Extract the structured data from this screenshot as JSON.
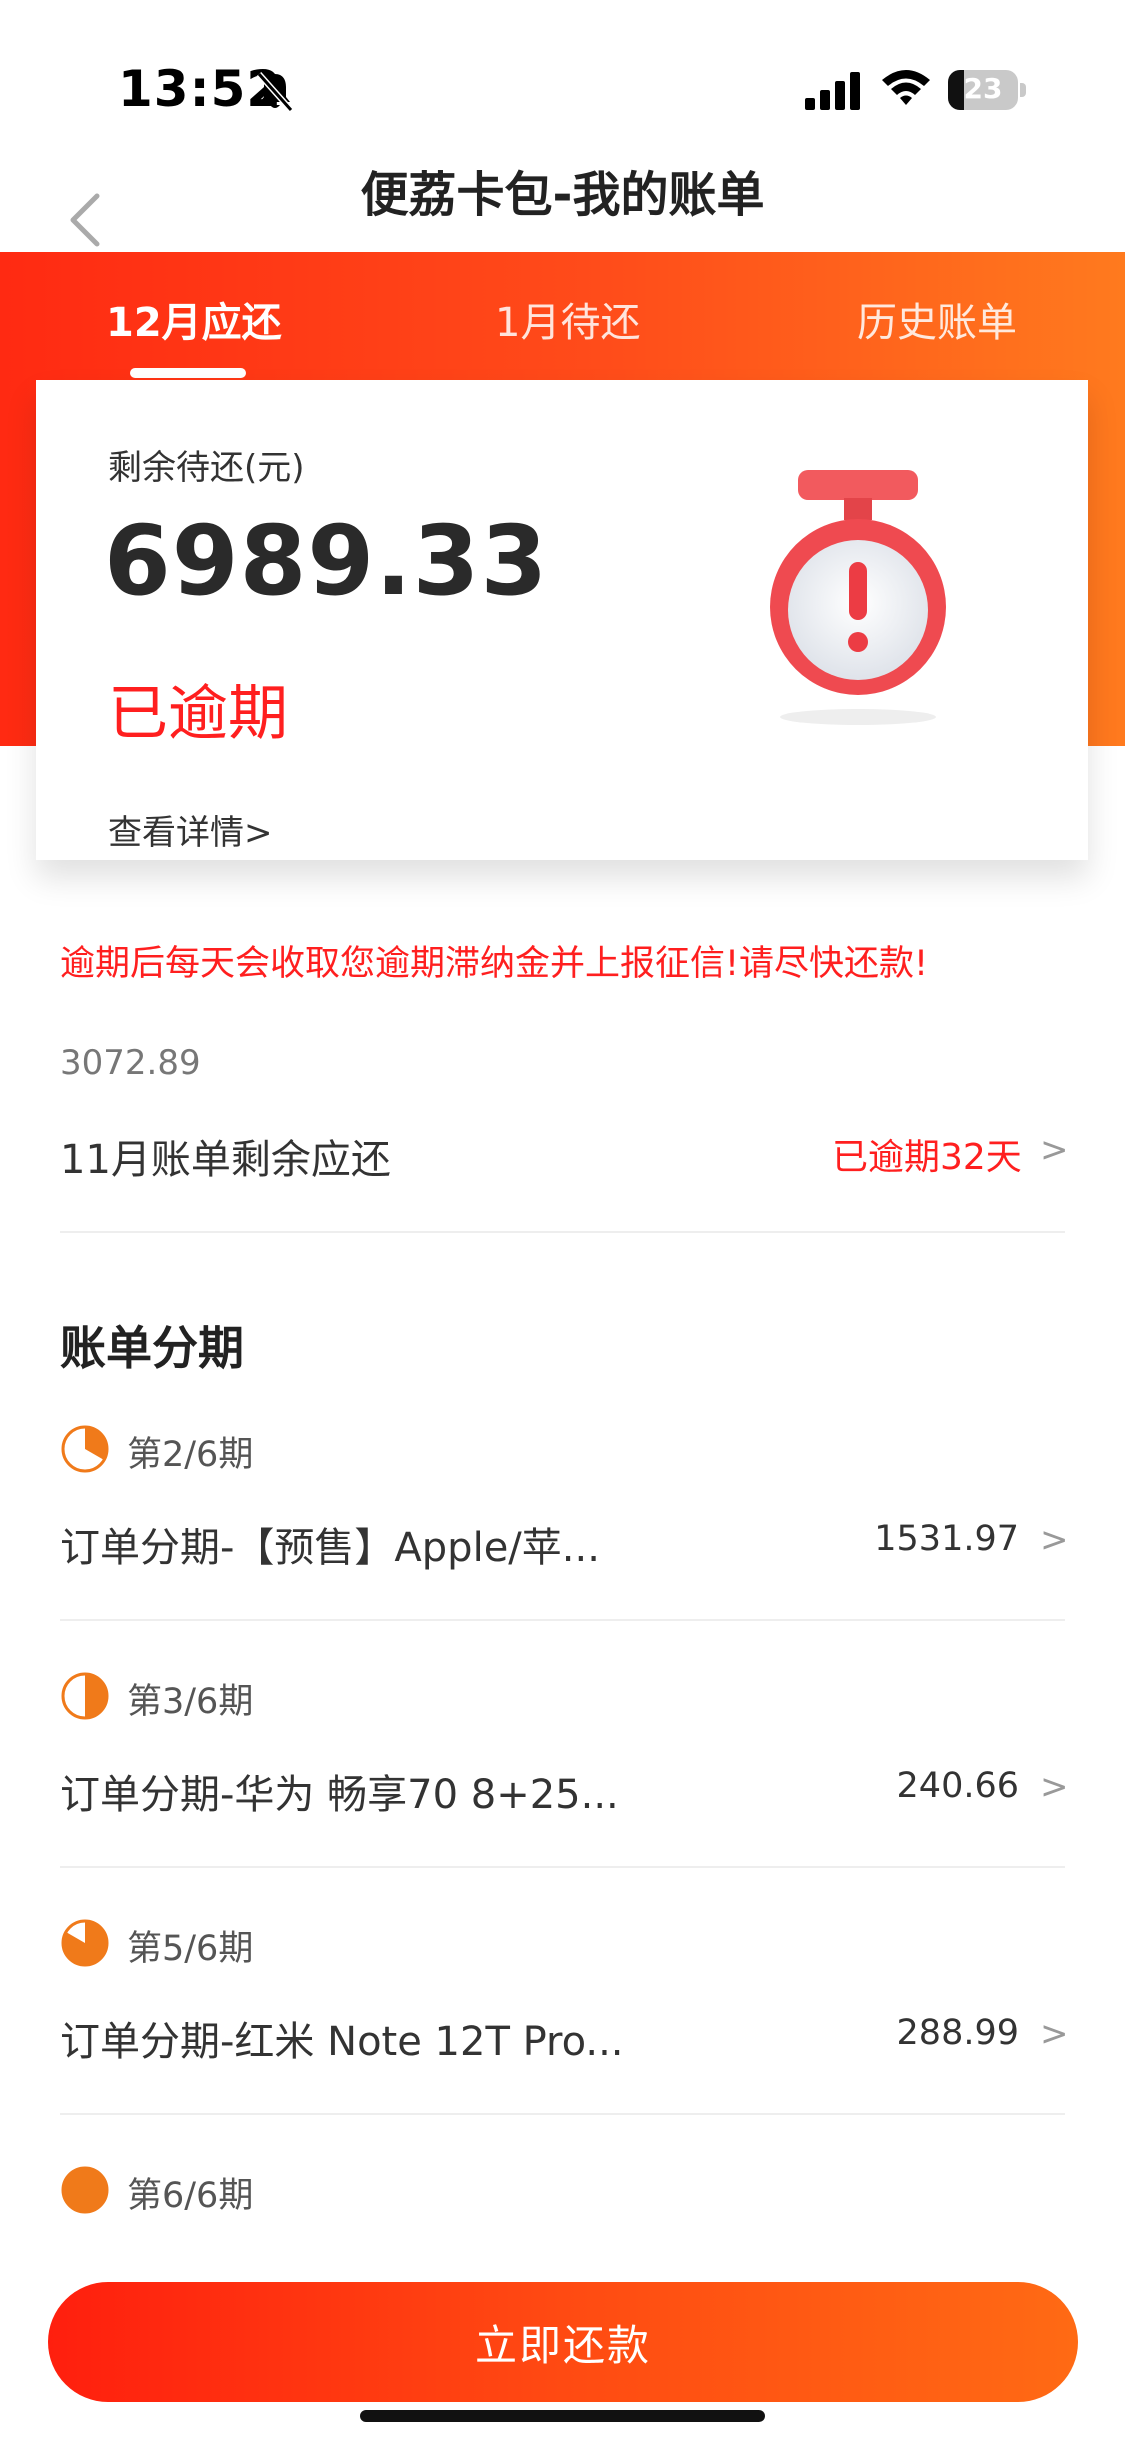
{
  "status_bar": {
    "time": "13:52",
    "battery": "23"
  },
  "nav": {
    "title": "便荔卡包-我的账单",
    "back_icon": "chevron-left-icon"
  },
  "tabs": [
    {
      "label": "12月应还",
      "active": true
    },
    {
      "label": "1月待还",
      "active": false
    },
    {
      "label": "历史账单",
      "active": false
    }
  ],
  "summary_card": {
    "label": "剩余待还(元)",
    "amount": "6989.33",
    "status": "已逾期",
    "detail_link": "查看详情>",
    "icon": "alarm-clock-warning-icon"
  },
  "warning": "逾期后每天会收取您逾期滞纳金并上报征信!请尽快还款!",
  "overdue_bill": {
    "amount": "3072.89",
    "title": "11月账单剩余应还",
    "status": "已逾期32天",
    "chevron": ">"
  },
  "installments": {
    "section_title": "账单分期",
    "items": [
      {
        "period": "第2/6期",
        "title": "订单分期-【预售】Apple/苹...",
        "amount": "1531.97",
        "chevron": ">",
        "progress": 0.3333
      },
      {
        "period": "第3/6期",
        "title": "订单分期-华为 畅享70 8+25...",
        "amount": "240.66",
        "chevron": ">",
        "progress": 0.5
      },
      {
        "period": "第5/6期",
        "title": "订单分期-红米 Note 12T Pro...",
        "amount": "288.99",
        "chevron": ">",
        "progress": 0.8333
      },
      {
        "period": "第6/6期",
        "progress": 1.0
      }
    ]
  },
  "pay_button": "立即还款",
  "colors": {
    "accent": "#ff3a14",
    "overdue_red": "#ff1f1f",
    "pie_orange": "#f07a1a"
  }
}
